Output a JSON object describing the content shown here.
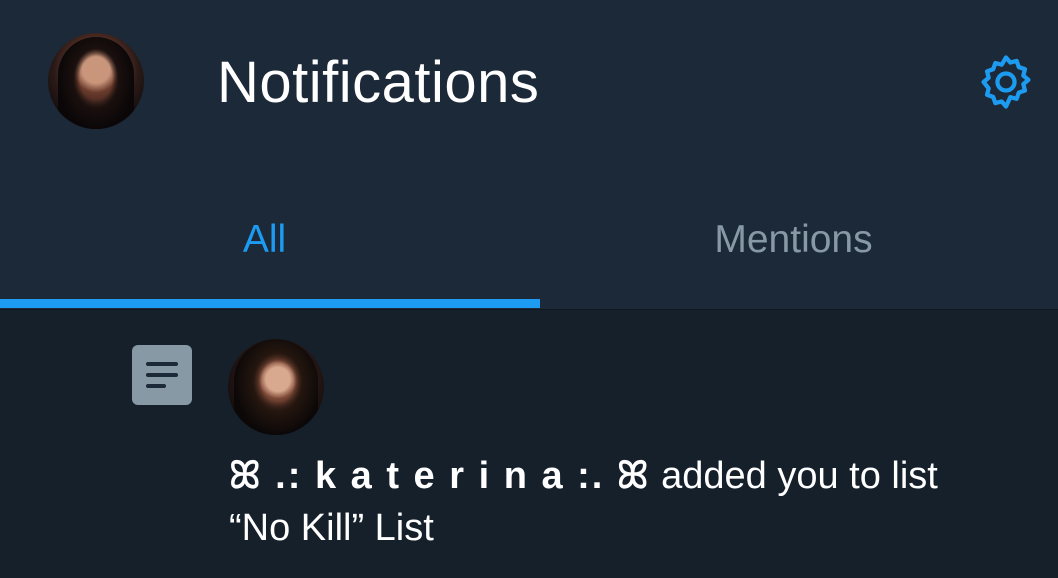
{
  "header": {
    "title": "Notifications",
    "avatar_icon": "profile-avatar",
    "settings_icon": "gear-icon"
  },
  "tabs": [
    {
      "label": "All",
      "selected": true
    },
    {
      "label": "Mentions",
      "selected": false
    }
  ],
  "notification": {
    "type_icon": "list-icon",
    "avatar_icon": "user-avatar",
    "actor_name": "ꕤ .: k a t e r i n a :. ꕤ",
    "message": " added you to list “No Kill” List"
  },
  "colors": {
    "accent": "#1d9bf0",
    "header_bg": "#1c2938",
    "body_bg": "#15202b",
    "muted": "#8899a6"
  }
}
